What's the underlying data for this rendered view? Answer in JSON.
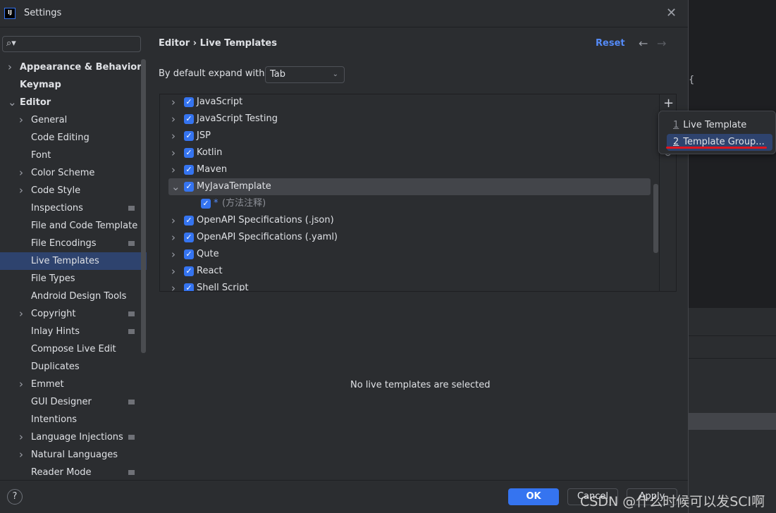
{
  "window": {
    "title": "Settings",
    "logo": "IJ",
    "close_icon": "close-icon"
  },
  "search": {
    "placeholder": "",
    "icon": "search-icon"
  },
  "sidebar": {
    "items": [
      {
        "label": "Appearance & Behavior",
        "level": 0,
        "chevron": "right",
        "bold": true
      },
      {
        "label": "Keymap",
        "level": 0,
        "bold": true
      },
      {
        "label": "Editor",
        "level": 0,
        "chevron": "down",
        "bold": true
      },
      {
        "label": "General",
        "level": 1,
        "chevron": "right"
      },
      {
        "label": "Code Editing",
        "level": 1
      },
      {
        "label": "Font",
        "level": 1
      },
      {
        "label": "Color Scheme",
        "level": 1,
        "chevron": "right"
      },
      {
        "label": "Code Style",
        "level": 1,
        "chevron": "right"
      },
      {
        "label": "Inspections",
        "level": 1,
        "project_icon": true
      },
      {
        "label": "File and Code Template",
        "level": 1
      },
      {
        "label": "File Encodings",
        "level": 1,
        "project_icon": true
      },
      {
        "label": "Live Templates",
        "level": 1,
        "selected": true
      },
      {
        "label": "File Types",
        "level": 1
      },
      {
        "label": "Android Design Tools",
        "level": 1
      },
      {
        "label": "Copyright",
        "level": 1,
        "chevron": "right",
        "project_icon": true
      },
      {
        "label": "Inlay Hints",
        "level": 1,
        "project_icon": true
      },
      {
        "label": "Compose Live Edit",
        "level": 1
      },
      {
        "label": "Duplicates",
        "level": 1
      },
      {
        "label": "Emmet",
        "level": 1,
        "chevron": "right"
      },
      {
        "label": "GUI Designer",
        "level": 1,
        "project_icon": true
      },
      {
        "label": "Intentions",
        "level": 1
      },
      {
        "label": "Language Injections",
        "level": 1,
        "chevron": "right",
        "project_icon": true
      },
      {
        "label": "Natural Languages",
        "level": 1,
        "chevron": "right"
      },
      {
        "label": "Reader Mode",
        "level": 1,
        "project_icon": true
      }
    ]
  },
  "header": {
    "breadcrumb": [
      "Editor",
      "Live Templates"
    ],
    "separator": "›",
    "reset": "Reset",
    "back_icon": "arrow-left-icon",
    "forward_icon": "arrow-right-icon"
  },
  "expand": {
    "label": "By default expand with",
    "value": "Tab"
  },
  "tree": [
    {
      "label": "JavaScript",
      "checked": true,
      "expanded": false
    },
    {
      "label": "JavaScript Testing",
      "checked": true,
      "expanded": false
    },
    {
      "label": "JSP",
      "checked": true,
      "expanded": false
    },
    {
      "label": "Kotlin",
      "checked": true,
      "expanded": false
    },
    {
      "label": "Maven",
      "checked": true,
      "expanded": false
    },
    {
      "label": "MyJavaTemplate",
      "checked": true,
      "expanded": true,
      "highlighted": true
    },
    {
      "label": "*",
      "desc": "(方法注释)",
      "checked": true,
      "child": true
    },
    {
      "label": "OpenAPI Specifications (.json)",
      "checked": true,
      "expanded": false
    },
    {
      "label": "OpenAPI Specifications (.yaml)",
      "checked": true,
      "expanded": false
    },
    {
      "label": "Qute",
      "checked": true,
      "expanded": false
    },
    {
      "label": "React",
      "checked": true,
      "expanded": false
    },
    {
      "label": "Shell Script",
      "checked": true,
      "expanded": false
    }
  ],
  "empty_message": "No live templates are selected",
  "popup": {
    "items": [
      {
        "key": "1",
        "label": "Live Template"
      },
      {
        "key": "2",
        "label": "Template Group...",
        "active": true
      }
    ]
  },
  "footer": {
    "help": "?",
    "ok": "OK",
    "cancel": "Cancel",
    "apply": "Apply"
  },
  "watermark": "CSDN @什么时候可以发SCI啊",
  "editor_bg": {
    "brace": "{"
  }
}
